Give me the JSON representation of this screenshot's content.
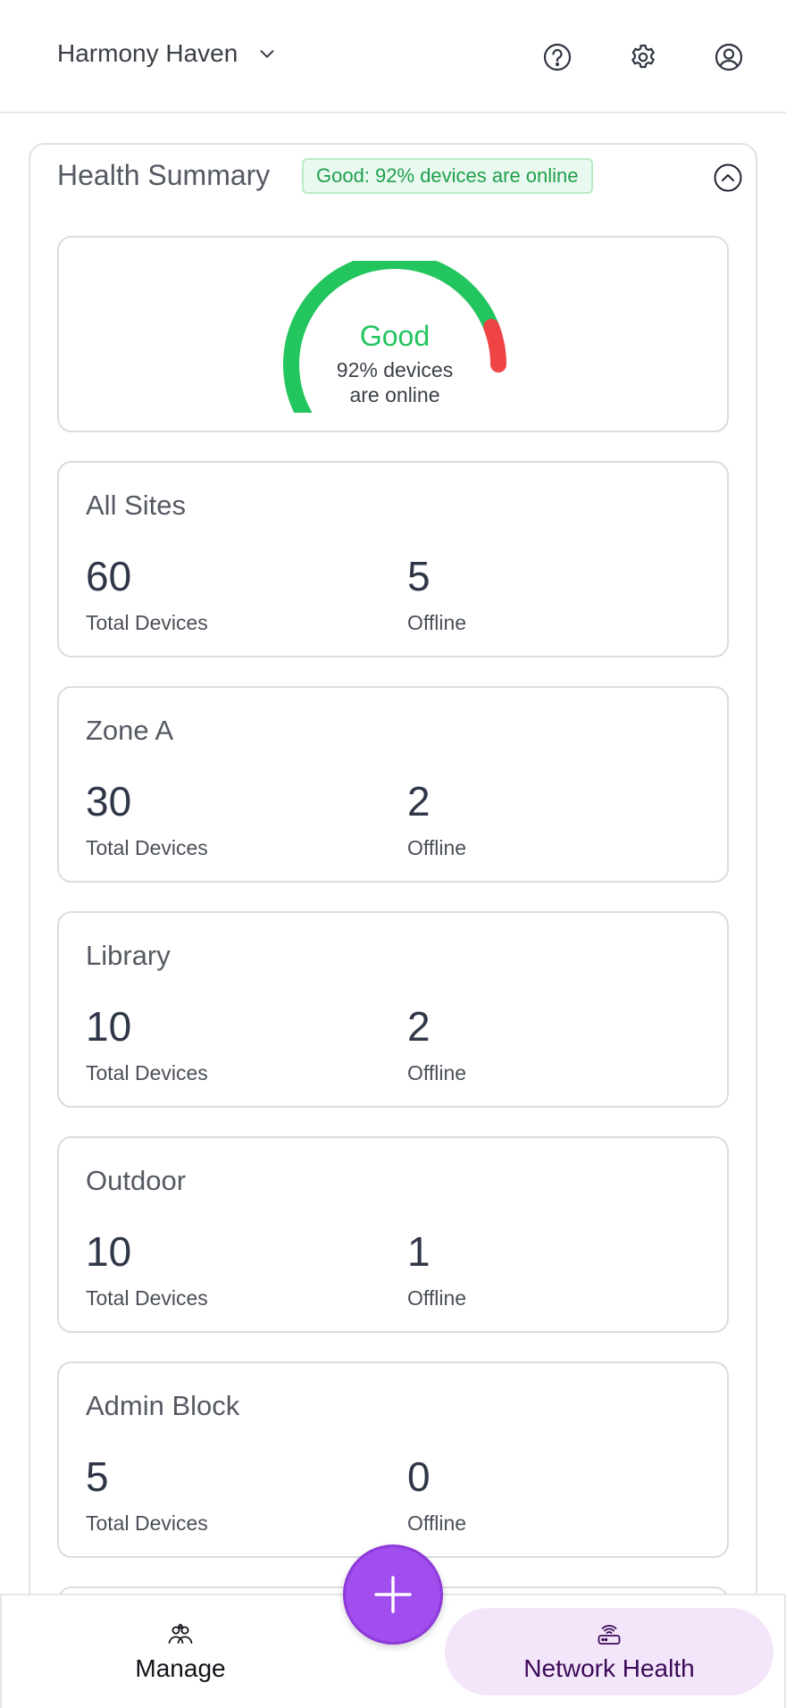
{
  "header": {
    "site_name": "Harmony Haven",
    "icons": [
      "help-icon",
      "settings-icon",
      "account-icon"
    ]
  },
  "summary": {
    "title": "Health Summary",
    "badge": "Good: 92% devices are online",
    "gauge": {
      "status": "Good",
      "line1": "92% devices",
      "line2": "are online",
      "online_fraction": 0.92,
      "good_color": "#22c55e",
      "bad_color": "#ef4444"
    }
  },
  "sites": [
    {
      "name": "All Sites",
      "total": "60",
      "total_label": "Total Devices",
      "offline": "5",
      "offline_label": "Offline"
    },
    {
      "name": "Zone A",
      "total": "30",
      "total_label": "Total Devices",
      "offline": "2",
      "offline_label": "Offline"
    },
    {
      "name": "Library",
      "total": "10",
      "total_label": "Total Devices",
      "offline": "2",
      "offline_label": "Offline"
    },
    {
      "name": "Outdoor",
      "total": "10",
      "total_label": "Total Devices",
      "offline": "1",
      "offline_label": "Offline"
    },
    {
      "name": "Admin Block",
      "total": "5",
      "total_label": "Total Devices",
      "offline": "0",
      "offline_label": "Offline"
    }
  ],
  "bottom_nav": {
    "manage": "Manage",
    "network_health": "Network Health",
    "active": "network_health",
    "accent": "#a24ded"
  }
}
